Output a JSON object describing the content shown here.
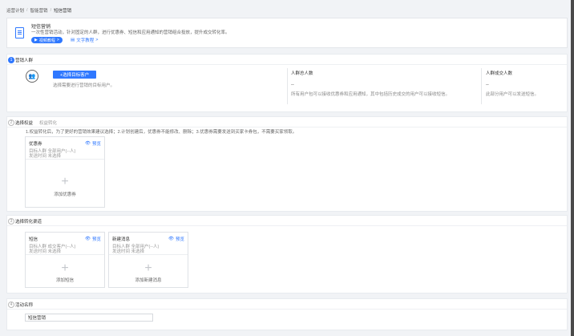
{
  "breadcrumb": [
    "运营计划",
    "智能营销",
    "短信营销"
  ],
  "banner": {
    "title": "短信营销",
    "desc": "一次性营销活动，针对固定的人群，进行优惠券、短信和应用通知的营销组合投放，提升成交转化率。",
    "video_label": "视频教程",
    "text_label": "文字教程"
  },
  "step1": {
    "num": "1",
    "title": "营销人群",
    "select_btn": "+选择目标客户",
    "hint": "选择需要进行营销的目标用户。",
    "cols": [
      {
        "label": "人群总人数",
        "value": "--",
        "desc": "所有用户包可以接收优惠券和应用通知，其中包括历史成交的用户可以接收短信。"
      },
      {
        "label": "人群成交人数",
        "value": "--",
        "desc": "此部分用户可以发送短信。"
      }
    ]
  },
  "step2": {
    "num": "2",
    "tab_active": "选择权益",
    "tab_inactive": "权益转化",
    "note": "1.权益转化后，为了更好的营销效果建议选择；2.计划创建后，优惠券不能修改、删除；3.优惠券需要发送到买家卡券包，不需要买家领取。",
    "card": {
      "title": "优惠券",
      "preview": "预览",
      "target": "目标人群  全部用户(--人)",
      "time": "发送时间  未选择",
      "add": "添加优惠券"
    }
  },
  "step3": {
    "num": "3",
    "title": "选择转化渠道",
    "cards": [
      {
        "title": "短信",
        "preview": "预览",
        "target": "目标人群  成交客户(--人)",
        "time": "发送时间  未选择",
        "add": "添加短信"
      },
      {
        "title": "新建消息",
        "preview": "预览",
        "target": "目标人群  全部用户(--人)",
        "time": "发送时间  未选择",
        "add": "添加新建消息"
      }
    ]
  },
  "step4": {
    "num": "4",
    "title": "活动名称",
    "input_value": "短信营销"
  }
}
